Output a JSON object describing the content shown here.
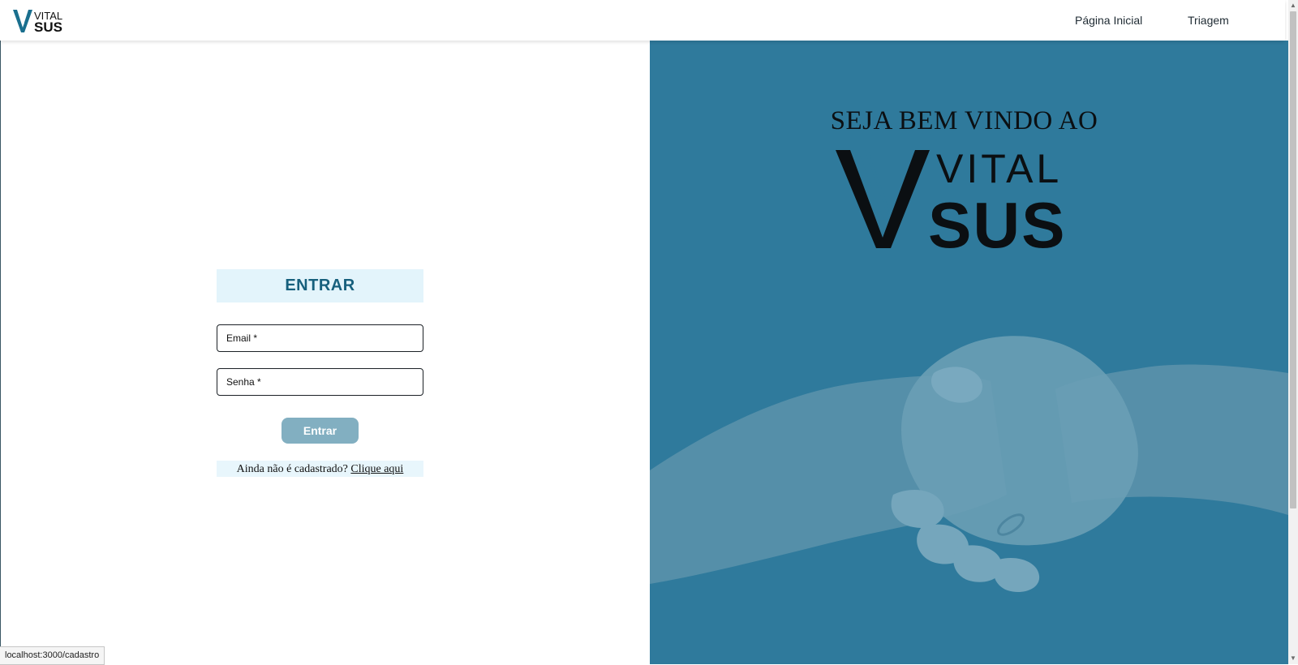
{
  "nav": {
    "logo_top": "VITAL",
    "logo_bottom": "SUS",
    "links": [
      "Página Inicial",
      "Triagem"
    ]
  },
  "login": {
    "title": "ENTRAR",
    "email_label": "Email *",
    "password_label": "Senha *",
    "submit_label": "Entrar",
    "register_prompt": "Ainda não é cadastrado?",
    "register_link": "Clique aqui"
  },
  "hero": {
    "welcome": "SEJA BEM VINDO AO",
    "logo_top": "VITAL",
    "logo_bottom": "SUS"
  },
  "status_bar": {
    "url": "localhost:3000/cadastro"
  },
  "colors": {
    "brand_dark": "#17607d",
    "title_bg": "#e3f4fb",
    "button": "#82afc1",
    "hero_bg": "#2f7a9c"
  }
}
